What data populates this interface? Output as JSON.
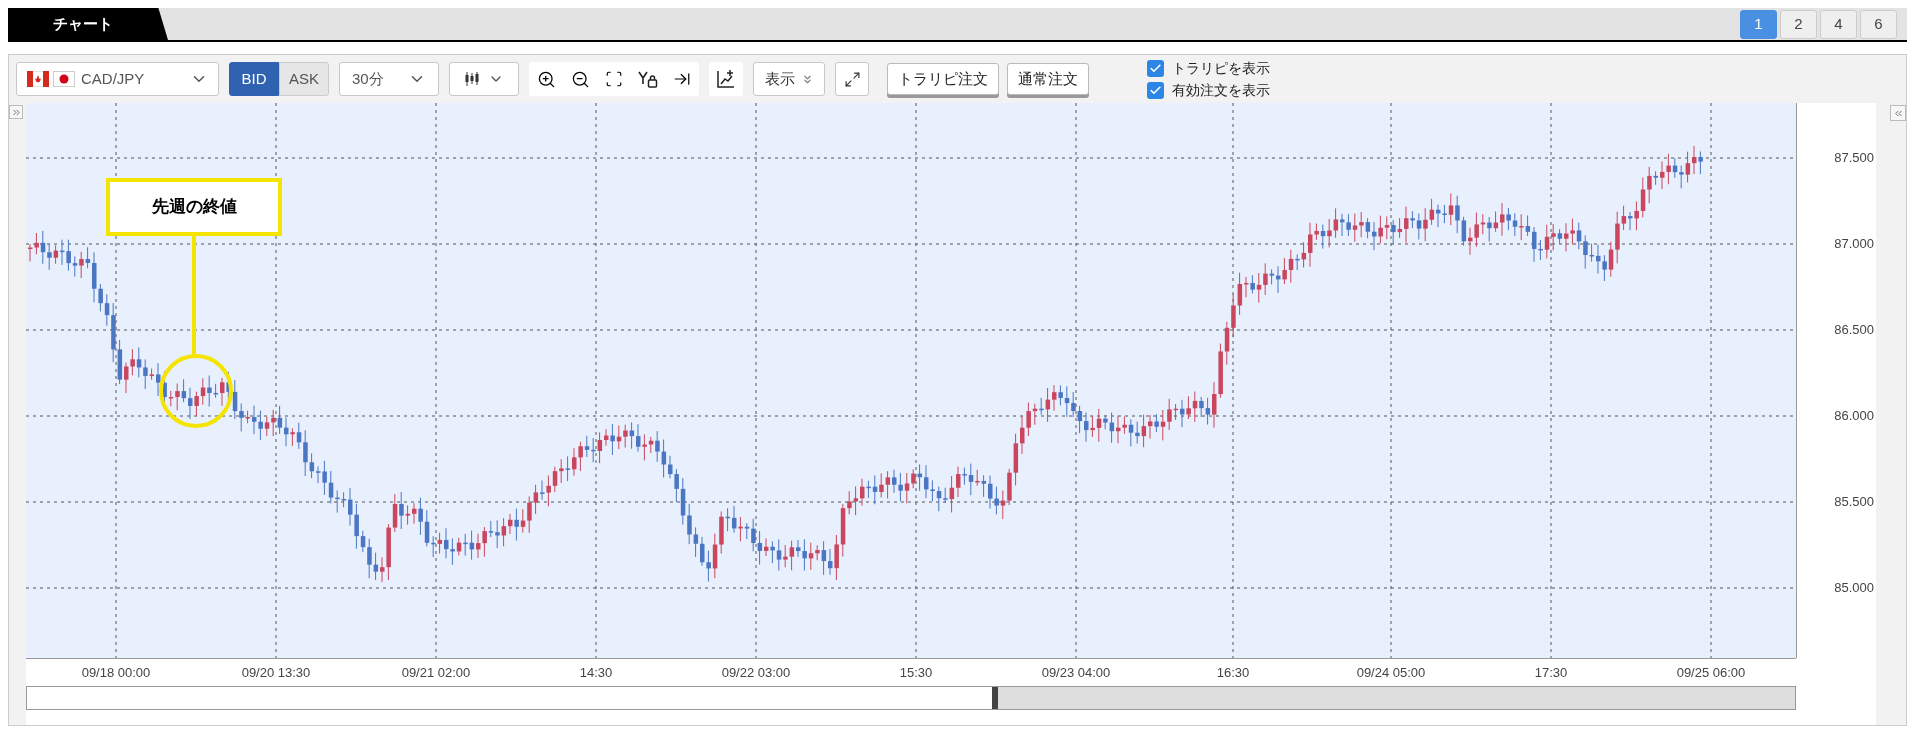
{
  "tabs": [
    {
      "label": "チャート",
      "selected": true
    }
  ],
  "layout_buttons": [
    {
      "label": "1",
      "selected": true
    },
    {
      "label": "2",
      "selected": false
    },
    {
      "label": "4",
      "selected": false
    },
    {
      "label": "6",
      "selected": false
    }
  ],
  "toolbar": {
    "currency_pair": "CAD/JPY",
    "price_types": [
      {
        "label": "BID",
        "selected": true
      },
      {
        "label": "ASK",
        "selected": false
      }
    ],
    "timeframe": "30分",
    "display_menu": "表示",
    "order_buttons": [
      "トラリピ注文",
      "通常注文"
    ],
    "checkboxes": [
      {
        "label": "トラリピを表示",
        "checked": true
      },
      {
        "label": "有効注文を表示",
        "checked": true
      }
    ]
  },
  "chart": {
    "annotation": "先週の終値",
    "y_axis_labels": [
      "87.500",
      "87.000",
      "86.500",
      "86.000",
      "85.500",
      "85.000"
    ],
    "x_axis_labels": [
      "09/18 00:00",
      "09/20 13:30",
      "09/21 02:00",
      "14:30",
      "09/22 03:00",
      "15:30",
      "09/23 04:00",
      "16:30",
      "09/24 05:00",
      "17:30",
      "09/25 06:00"
    ]
  }
}
